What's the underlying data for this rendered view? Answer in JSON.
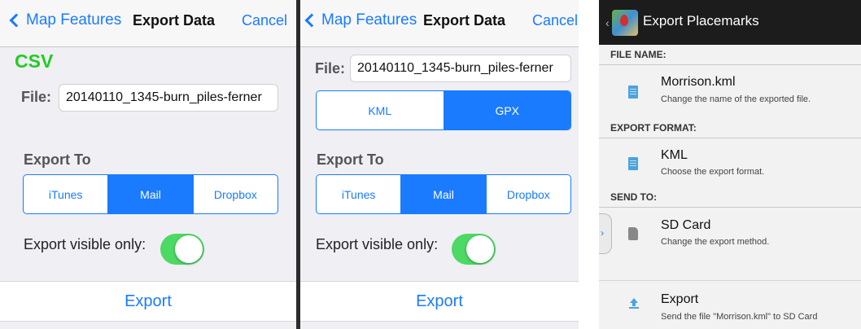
{
  "colors": {
    "ios_blue": "#1a7bff",
    "toggle_green": "#4cd964",
    "csv_green": "#22cc22",
    "android_bar": "#1c1c1c"
  },
  "panel1": {
    "nav": {
      "back_label": "Map Features",
      "title": "Export Data",
      "cancel_label": "Cancel"
    },
    "format_label": "CSV",
    "file": {
      "label": "File:",
      "value": "20140110_1345-burn_piles-ferner"
    },
    "export_to": {
      "label": "Export To",
      "options": [
        "iTunes",
        "Mail",
        "Dropbox"
      ],
      "selected": "Mail"
    },
    "visible_only": {
      "label": "Export visible only:",
      "on": true
    },
    "export_button": "Export"
  },
  "panel2": {
    "nav": {
      "back_label": "Map Features",
      "title": "Export Data",
      "cancel_label": "Cancel"
    },
    "file": {
      "label": "File:",
      "value": "20140110_1345-burn_piles-ferner"
    },
    "format": {
      "options": [
        "KML",
        "GPX"
      ],
      "selected": "GPX"
    },
    "export_to": {
      "label": "Export To",
      "options": [
        "iTunes",
        "Mail",
        "Dropbox"
      ],
      "selected": "Mail"
    },
    "visible_only": {
      "label": "Export visible only:",
      "on": true
    },
    "export_button": "Export"
  },
  "panel3": {
    "back_glyph": "‹",
    "title": "Export Placemarks",
    "sections": {
      "file_name": "FILE NAME:",
      "export_format": "EXPORT FORMAT:",
      "send_to": "SEND TO:"
    },
    "items": {
      "file": {
        "icon": "document-icon",
        "primary": "Morrison.kml",
        "secondary": "Change the name of the exported file."
      },
      "format": {
        "icon": "document-icon",
        "primary": "KML",
        "secondary": "Choose the export format."
      },
      "send": {
        "icon": "sd-card-icon",
        "primary": "SD Card",
        "secondary": "Change the export method."
      },
      "export": {
        "icon": "upload-arrow-icon",
        "primary": "Export",
        "secondary": "Send the file \"Morrison.kml\" to SD Card"
      }
    },
    "drawer_tab_glyph": "›"
  }
}
